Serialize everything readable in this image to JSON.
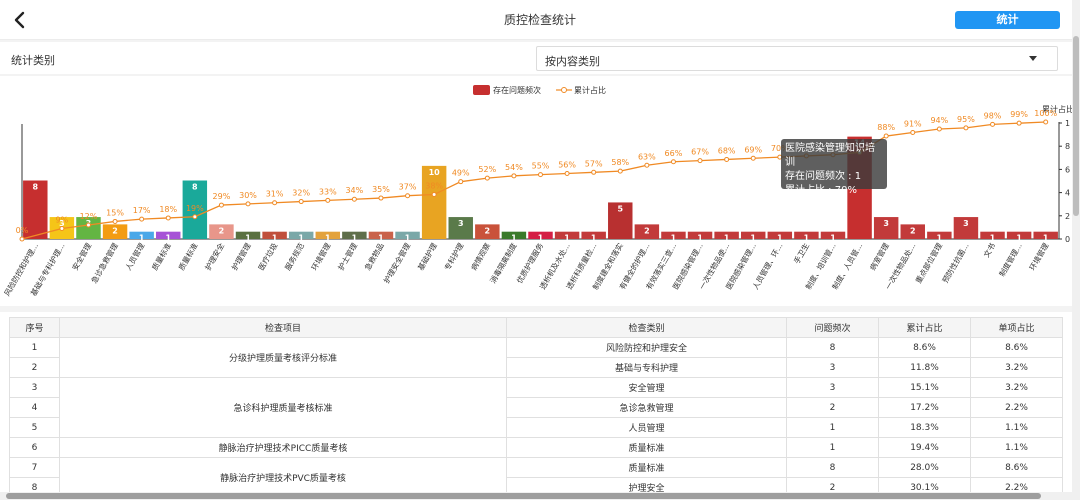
{
  "header": {
    "title": "质控检查统计",
    "stat_button": "统计"
  },
  "filter": {
    "label": "统计类别",
    "selected": "按内容类别"
  },
  "chart_data": {
    "type": "bar",
    "legend": {
      "bar": "存在问题频次",
      "line": "累计占比",
      "position": "top-center"
    },
    "y2label": "累计占比",
    "y_ticks": [
      "0",
      "2",
      "4",
      "6",
      "8",
      "1"
    ],
    "categories": [
      "风险防控和护理...",
      "基础与专科护理...",
      "安全管理",
      "急诊急救管理",
      "人员管理",
      "质量标准",
      "质量标准",
      "护理安全",
      "护理管理",
      "医疗垃圾",
      "服务规范",
      "环境管理",
      "护士管理",
      "急救物品",
      "护理安全管理",
      "基础护理",
      "专科护理",
      "病情观察",
      "消毒隔离制度",
      "优质护理服务",
      "透析机及水处...",
      "透析科质量检...",
      "制度建全和落实",
      "有健全的护理...",
      "有效落实三查...",
      "医院感染管理...",
      "一次性物品使...",
      "医院感染管理...",
      "人员管理、环...",
      "手卫生",
      "制度、培训管...",
      "制度、人员管...",
      "病室管理",
      "一次性物品处...",
      "重点部位管理",
      "预防性抗菌...",
      "文书",
      "制度管理...",
      "环境管理"
    ],
    "values": [
      8,
      3,
      3,
      2,
      1,
      1,
      8,
      2,
      1,
      1,
      1,
      1,
      1,
      1,
      1,
      10,
      3,
      2,
      1,
      1,
      1,
      1,
      5,
      2,
      1,
      1,
      1,
      1,
      1,
      1,
      1,
      14,
      3,
      2,
      1,
      3,
      1,
      1,
      1
    ],
    "bar_colors": [
      "#c62f2f",
      "#f5c518",
      "#63b543",
      "#f39c12",
      "#4aa8e8",
      "#a653d6",
      "#1aa99a",
      "#e8968a",
      "#5a7040",
      "#c0503c",
      "#7aa8a8",
      "#e3a23c",
      "#5e6e4a",
      "#c9624a",
      "#7aa8a8",
      "#e8a422",
      "#5a7a4a",
      "#c9523a",
      "#3a7a2a",
      "#d41e44",
      "#c23a3a",
      "#c23a3a",
      "#b83030",
      "#c23a3a",
      "#c23a3a",
      "#c23a3a",
      "#c23a3a",
      "#c23a3a",
      "#c23a3a",
      "#c23a3a",
      "#c23a3a",
      "#c62f2f",
      "#c23a3a",
      "#c23a3a",
      "#c23a3a",
      "#c23a3a",
      "#c23a3a",
      "#c23a3a",
      "#c23a3a"
    ],
    "cumulative_labels": [
      "0%",
      "9%",
      "12%",
      "15%",
      "17%",
      "18%",
      "19%",
      "29%",
      "30%",
      "31%",
      "32%",
      "33%",
      "34%",
      "35%",
      "37%",
      "38%",
      "49%",
      "52%",
      "54%",
      "55%",
      "56%",
      "57%",
      "58%",
      "63%",
      "66%",
      "67%",
      "68%",
      "69%",
      "70%",
      "",
      "",
      "",
      "88%",
      "91%",
      "94%",
      "95%",
      "98%",
      "99%",
      "100%"
    ],
    "cumulative_values": [
      0,
      9,
      12,
      15,
      17,
      18,
      19,
      29,
      30,
      31,
      32,
      33,
      34,
      35,
      37,
      38,
      49,
      52,
      54,
      55,
      56,
      57,
      58,
      63,
      66,
      67,
      68,
      69,
      70,
      71,
      72,
      74,
      88,
      91,
      94,
      95,
      98,
      99,
      100
    ],
    "tooltip": {
      "title": "医院感染管理知识培训",
      "line1": "存在问题频次 : 1",
      "line2": "累计占比 : 70%"
    }
  },
  "table": {
    "headers": [
      "序号",
      "检查项目",
      "检查类别",
      "问题频次",
      "累计占比",
      "单项占比"
    ],
    "rows": [
      {
        "no": "1",
        "item": "分级护理质量考核评分标准",
        "category": "风险防控和护理安全",
        "freq": "8",
        "cum": "8.6%",
        "single": "8.6%"
      },
      {
        "no": "2",
        "item": "",
        "category": "基础与专科护理",
        "freq": "3",
        "cum": "11.8%",
        "single": "3.2%"
      },
      {
        "no": "3",
        "item": "急诊科护理质量考核标准",
        "category": "安全管理",
        "freq": "3",
        "cum": "15.1%",
        "single": "3.2%"
      },
      {
        "no": "4",
        "item": "",
        "category": "急诊急救管理",
        "freq": "2",
        "cum": "17.2%",
        "single": "2.2%"
      },
      {
        "no": "5",
        "item": "",
        "category": "人员管理",
        "freq": "1",
        "cum": "18.3%",
        "single": "1.1%"
      },
      {
        "no": "6",
        "item": "静脉治疗护理技术PICC质量考核",
        "category": "质量标准",
        "freq": "1",
        "cum": "19.4%",
        "single": "1.1%"
      },
      {
        "no": "7",
        "item": "静脉治疗护理技术PVC质量考核",
        "category": "质量标准",
        "freq": "8",
        "cum": "28.0%",
        "single": "8.6%"
      },
      {
        "no": "8",
        "item": "",
        "category": "护理安全",
        "freq": "2",
        "cum": "30.1%",
        "single": "2.2%"
      }
    ]
  }
}
